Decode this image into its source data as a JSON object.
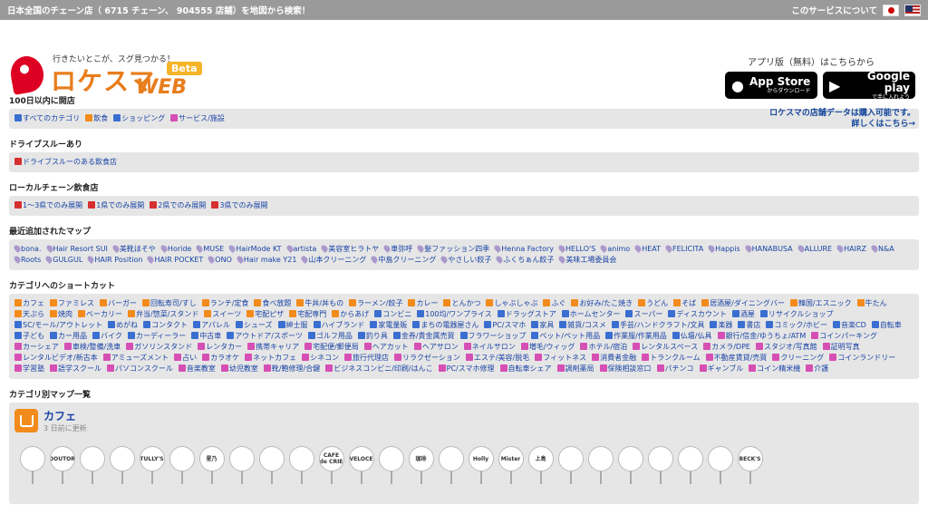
{
  "topbar": {
    "title": "日本全国のチェーン店（ 6715 チェーン、 904555 店舗）を地図から検索！",
    "about": "このサービスについて"
  },
  "logo": {
    "tagline": "行きたいとこが、スグ見つかる！",
    "name": "ロケスマ",
    "web": "WEB",
    "beta": "Beta"
  },
  "apps": {
    "label": "アプリ版（無料）はこちらから",
    "appstore_small": "からダウンロード",
    "appstore_big": "App Store",
    "googleplay_small": "で手に入れよう",
    "googleplay_big": "Google play",
    "notice_line1": "ロケスマの店舗データは購入可能です。",
    "notice_line2": "詳しくはこちら→"
  },
  "sections": {
    "new_open": {
      "title": "100日以内に開店",
      "items": [
        {
          "label": "すべてのカテゴリ",
          "icon": "ic-blue"
        },
        {
          "label": "飲食",
          "icon": "ic-orange"
        },
        {
          "label": "ショッピング",
          "icon": "ic-blue"
        },
        {
          "label": "サービス/施設",
          "icon": "ic-pink"
        }
      ]
    },
    "drive": {
      "title": "ドライブスルーあり",
      "items": [
        {
          "label": "ドライブスルーのある飲食店",
          "icon": "ic-red"
        }
      ]
    },
    "local": {
      "title": "ローカルチェーン飲食店",
      "items": [
        {
          "label": "1〜3県でのみ展開",
          "icon": "ic-red"
        },
        {
          "label": "1県でのみ展開",
          "icon": "ic-red"
        },
        {
          "label": "2県でのみ展開",
          "icon": "ic-red"
        },
        {
          "label": "3県でのみ展開",
          "icon": "ic-red"
        }
      ]
    },
    "recent": {
      "title": "最近追加されたマップ",
      "items": [
        "bona.",
        "Hair Resort SUI",
        "美靴ほそや",
        "Horide",
        "MUSE",
        "HairMode KT",
        "artista",
        "美容室ヒラトヤ",
        "車弥呼",
        "髪ファッション四季",
        "Henna Factory",
        "HELLO'S",
        "animo",
        "HEAT",
        "FELICITA",
        "Happis",
        "HANABUSA",
        "ALLURE",
        "HAIRZ",
        "N&A",
        "Roots",
        "GULGUL",
        "HAIR Position",
        "HAIR POCKET",
        "ONO",
        "Hair make Y21",
        "山本クリーニング",
        "中島クリーニング",
        "やさしい餃子",
        "ふくちぁん餃子",
        "美味工場委員会"
      ]
    },
    "shortcuts": {
      "title": "カテゴリへのショートカット",
      "items": [
        "カフェ",
        "ファミレス",
        "バーガー",
        "回転寿司/すし",
        "ランチ/定食",
        "食べ放題",
        "牛丼/丼もの",
        "ラーメン/餃子",
        "カレー",
        "とんかつ",
        "しゃぶしゃぶ",
        "ふぐ",
        "お好み/たこ焼き",
        "うどん",
        "そば",
        "居酒屋/ダイニングバー",
        "韓国/エスニック",
        "牛たん",
        "天ぷら",
        "焼肉",
        "ベーカリー",
        "弁当/惣菜/スタンド",
        "スイーツ",
        "宅配ピザ",
        "宅配専門",
        "からあげ",
        "コンビニ",
        "100均/ワンプライス",
        "ドラッグストア",
        "ホームセンター",
        "スーパー",
        "ディスカウント",
        "酒屋",
        "リサイクルショップ",
        "SC/モール/アウトレット",
        "めがね",
        "コンタクト",
        "アパレル",
        "シューズ",
        "紳士服",
        "ハイブランド",
        "家電量販",
        "まちの電器屋さん",
        "PC/スマホ",
        "家具",
        "雑貨/コスメ",
        "手芸/ハンドクラフト/文具",
        "楽器",
        "書店",
        "コミック/ホビー",
        "音楽CD",
        "自転車",
        "子ども",
        "カー用品",
        "バイク",
        "カーディーラー",
        "中古車",
        "アウトドア/スポーツ",
        "ゴルフ用品",
        "釣り具",
        "金券/貴金属売買",
        "フラワーショップ",
        "ペット/ペット用品",
        "作業服/作業用品",
        "仏壇/仏具",
        "銀行/信金/ゆうちょ/ATM",
        "コインパーキング",
        "カーシェア",
        "車検/整備/洗車",
        "ガソリンスタンド",
        "レンタカー",
        "携帯キャリア",
        "宅配便/郵便局",
        "ヘアカット",
        "ヘアサロン",
        "ネイルサロン",
        "増毛/ウィッグ",
        "ホテル/宿泊",
        "レンタルスペース",
        "カメラ/DPE",
        "スタジオ/写真館",
        "証明写真",
        "レンタルビデオ/新古本",
        "アミューズメント",
        "占い",
        "カラオケ",
        "ネットカフェ",
        "シネコン",
        "旅行代理店",
        "リラクゼーション",
        "エステ/美容/脱毛",
        "フィットネス",
        "消費者金融",
        "トランクルーム",
        "不動産賃貸/売買",
        "クリーニング",
        "コインランドリー",
        "学習塾",
        "語学スクール",
        "パソコンスクール",
        "音楽教室",
        "幼児教室",
        "靴/鞄修理/合鍵",
        "ビジネスコンビニ/印刷/はんこ",
        "PC/スマホ修理",
        "自転車シェア",
        "調剤薬局",
        "保険相談窓口",
        "パチンコ",
        "ギャンブル",
        "コイン精米機",
        "介護"
      ]
    },
    "catmaps": {
      "title": "カテゴリ別マップ一覧",
      "cafe_title": "カフェ",
      "cafe_updated": "3 日前に更新",
      "logos": [
        "",
        "DOUTOR",
        "",
        "",
        "TULLY'S",
        "",
        "星乃",
        "",
        "",
        "",
        "CAFE de CRIE",
        "VELOCE",
        "",
        "珈琲",
        "",
        "Holly",
        "Mister",
        "上島",
        "",
        "",
        "",
        "",
        "",
        "",
        "BECK'S"
      ]
    }
  }
}
